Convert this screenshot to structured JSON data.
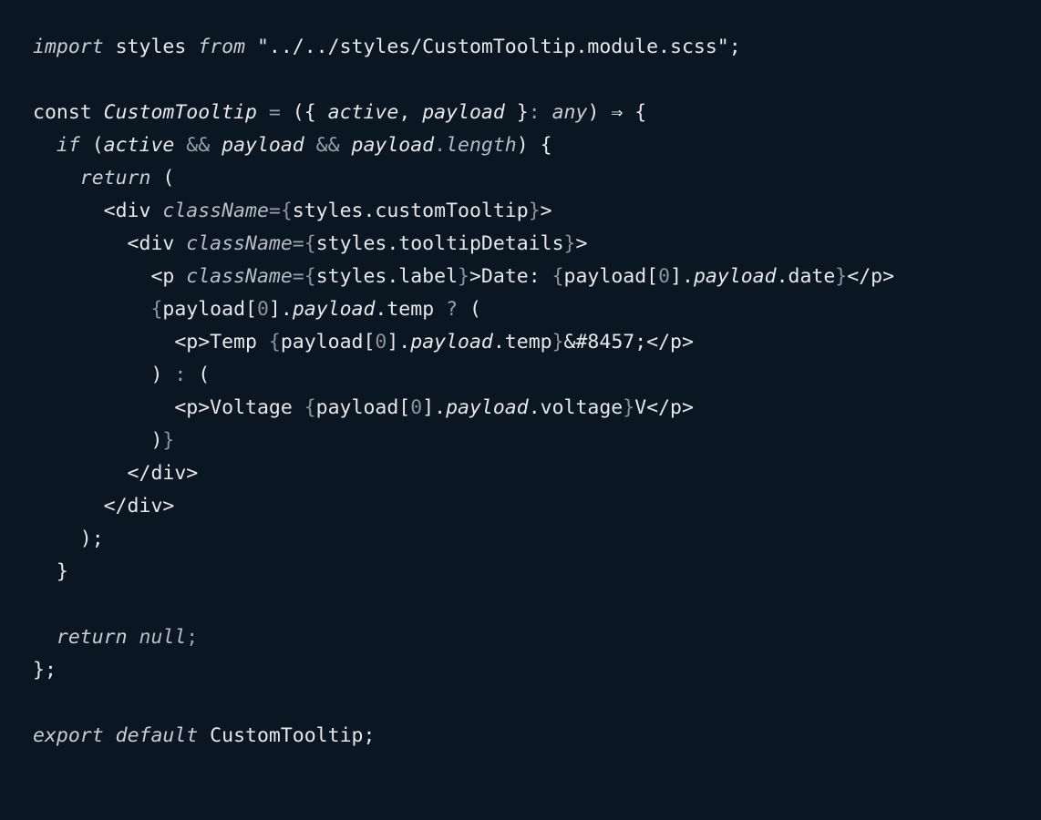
{
  "editor": {
    "background": "#0b1623",
    "lines": [
      [
        {
          "t": "import",
          "s": "kw"
        },
        {
          "t": " styles ",
          "s": "plain"
        },
        {
          "t": "from",
          "s": "kw"
        },
        {
          "t": " \"../../styles/CustomTooltip.module.scss\";",
          "s": "str"
        }
      ],
      [],
      [
        {
          "t": "const ",
          "s": "plain"
        },
        {
          "t": "CustomTooltip",
          "s": "ital"
        },
        {
          "t": " = ",
          "s": "gray"
        },
        {
          "t": "({ ",
          "s": "plain"
        },
        {
          "t": "active",
          "s": "ital"
        },
        {
          "t": ", ",
          "s": "plain"
        },
        {
          "t": "payload",
          "s": "ital"
        },
        {
          "t": " }",
          "s": "plain"
        },
        {
          "t": ": ",
          "s": "gray"
        },
        {
          "t": "any",
          "s": "kw"
        },
        {
          "t": ") ⇒ {",
          "s": "plain"
        }
      ],
      [
        {
          "t": "  ",
          "s": "plain"
        },
        {
          "t": "if",
          "s": "kw"
        },
        {
          "t": " (",
          "s": "plain"
        },
        {
          "t": "active",
          "s": "ital"
        },
        {
          "t": " && ",
          "s": "gray"
        },
        {
          "t": "payload",
          "s": "ital"
        },
        {
          "t": " && ",
          "s": "gray"
        },
        {
          "t": "payload",
          "s": "ital"
        },
        {
          "t": ".",
          "s": "gray"
        },
        {
          "t": "length",
          "s": "attr"
        },
        {
          "t": ") {",
          "s": "plain"
        }
      ],
      [
        {
          "t": "    ",
          "s": "plain"
        },
        {
          "t": "return",
          "s": "kw"
        },
        {
          "t": " (",
          "s": "plain"
        }
      ],
      [
        {
          "t": "      <div ",
          "s": "plain"
        },
        {
          "t": "className",
          "s": "attr"
        },
        {
          "t": "=",
          "s": "gray"
        },
        {
          "t": "{",
          "s": "dim"
        },
        {
          "t": "styles.customTooltip",
          "s": "plain"
        },
        {
          "t": "}",
          "s": "dim"
        },
        {
          "t": ">",
          "s": "plain"
        }
      ],
      [
        {
          "t": "        <div ",
          "s": "plain"
        },
        {
          "t": "className",
          "s": "attr"
        },
        {
          "t": "=",
          "s": "gray"
        },
        {
          "t": "{",
          "s": "dim"
        },
        {
          "t": "styles.tooltipDetails",
          "s": "plain"
        },
        {
          "t": "}",
          "s": "dim"
        },
        {
          "t": ">",
          "s": "plain"
        }
      ],
      [
        {
          "t": "          <p ",
          "s": "plain"
        },
        {
          "t": "className",
          "s": "attr"
        },
        {
          "t": "=",
          "s": "gray"
        },
        {
          "t": "{",
          "s": "dim"
        },
        {
          "t": "styles.label",
          "s": "plain"
        },
        {
          "t": "}",
          "s": "dim"
        },
        {
          "t": ">Date: ",
          "s": "plain"
        },
        {
          "t": "{",
          "s": "dim"
        },
        {
          "t": "payload[",
          "s": "plain"
        },
        {
          "t": "0",
          "s": "num"
        },
        {
          "t": "].",
          "s": "plain"
        },
        {
          "t": "payload",
          "s": "ital"
        },
        {
          "t": ".date",
          "s": "plain"
        },
        {
          "t": "}",
          "s": "dim"
        },
        {
          "t": "</p>",
          "s": "plain"
        }
      ],
      [
        {
          "t": "          ",
          "s": "plain"
        },
        {
          "t": "{",
          "s": "dim"
        },
        {
          "t": "payload[",
          "s": "plain"
        },
        {
          "t": "0",
          "s": "num"
        },
        {
          "t": "].",
          "s": "plain"
        },
        {
          "t": "payload",
          "s": "ital"
        },
        {
          "t": ".temp ",
          "s": "plain"
        },
        {
          "t": "?",
          "s": "gray"
        },
        {
          "t": " (",
          "s": "plain"
        }
      ],
      [
        {
          "t": "            <p>Temp ",
          "s": "plain"
        },
        {
          "t": "{",
          "s": "dim"
        },
        {
          "t": "payload[",
          "s": "plain"
        },
        {
          "t": "0",
          "s": "num"
        },
        {
          "t": "].",
          "s": "plain"
        },
        {
          "t": "payload",
          "s": "ital"
        },
        {
          "t": ".temp",
          "s": "plain"
        },
        {
          "t": "}",
          "s": "dim"
        },
        {
          "t": "&#8457;</p>",
          "s": "plain"
        }
      ],
      [
        {
          "t": "          ) ",
          "s": "plain"
        },
        {
          "t": ":",
          "s": "gray"
        },
        {
          "t": " (",
          "s": "plain"
        }
      ],
      [
        {
          "t": "            <p>Voltage ",
          "s": "plain"
        },
        {
          "t": "{",
          "s": "dim"
        },
        {
          "t": "payload[",
          "s": "plain"
        },
        {
          "t": "0",
          "s": "num"
        },
        {
          "t": "].",
          "s": "plain"
        },
        {
          "t": "payload",
          "s": "ital"
        },
        {
          "t": ".voltage",
          "s": "plain"
        },
        {
          "t": "}",
          "s": "dim"
        },
        {
          "t": "V</p>",
          "s": "plain"
        }
      ],
      [
        {
          "t": "          )",
          "s": "plain"
        },
        {
          "t": "}",
          "s": "dim"
        }
      ],
      [
        {
          "t": "        </div>",
          "s": "plain"
        }
      ],
      [
        {
          "t": "      </div>",
          "s": "plain"
        }
      ],
      [
        {
          "t": "    );",
          "s": "plain"
        }
      ],
      [
        {
          "t": "  }",
          "s": "plain"
        }
      ],
      [],
      [
        {
          "t": "  ",
          "s": "plain"
        },
        {
          "t": "return",
          "s": "kw"
        },
        {
          "t": " ",
          "s": "plain"
        },
        {
          "t": "null",
          "s": "attr"
        },
        {
          "t": ";",
          "s": "gray"
        }
      ],
      [
        {
          "t": "};",
          "s": "plain"
        }
      ],
      [],
      [
        {
          "t": "export",
          "s": "kw"
        },
        {
          "t": " ",
          "s": "plain"
        },
        {
          "t": "default",
          "s": "kw"
        },
        {
          "t": " CustomTooltip;",
          "s": "plain"
        }
      ]
    ]
  }
}
